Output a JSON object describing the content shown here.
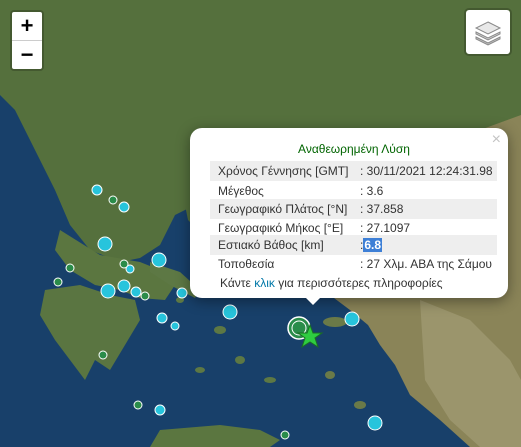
{
  "map": {
    "colors": {
      "sea": "#18406a",
      "land": "#4f6e3a",
      "quake_cyan": "#27c4dc",
      "quake_green": "#2a8c4a",
      "selected_star": "#2ecc40"
    }
  },
  "controls": {
    "zoom_in": "+",
    "zoom_out": "−",
    "layers_icon": "layers-icon"
  },
  "popup": {
    "close": "×",
    "title": "Αναθεωρημένη Λύση",
    "rows": [
      {
        "label": "Χρόνος Γέννησης [GMT]",
        "value": ": 30/11/2021 12:24:31.98"
      },
      {
        "label": "Μέγεθος",
        "value": ": 3.6"
      },
      {
        "label": "Γεωγραφικό Πλάτος [°N]",
        "value": ": 37.858"
      },
      {
        "label": "Γεωγραφικό Μήκος [°E]",
        "value": ": 27.1097"
      },
      {
        "label": "Εστιακό Βάθος [km]",
        "value_prefix": ":",
        "value_highlight": "6.8"
      },
      {
        "label": "Τοποθεσία",
        "value": ": 27 Χλμ. ΑΒΑ της Σάμου"
      }
    ],
    "footer_before": "Κάντε ",
    "footer_link": "κλικ",
    "footer_after": " για περισσότερες πληροφορίες"
  }
}
